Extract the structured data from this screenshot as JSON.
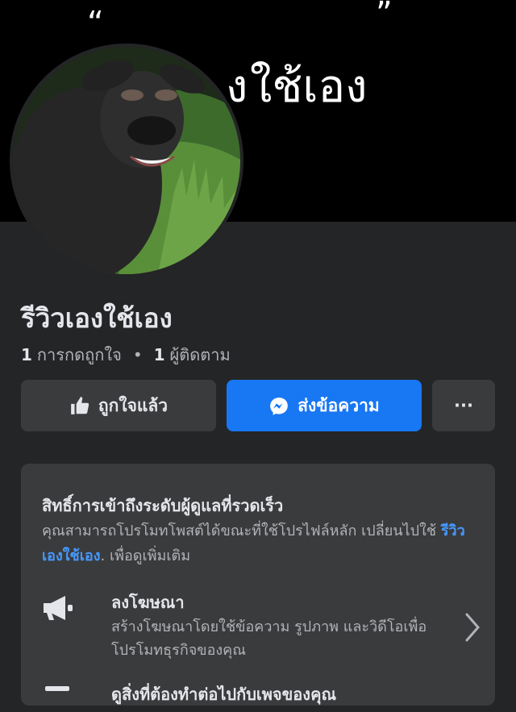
{
  "cover": {
    "text": "“ ..เองใช้เอง ”"
  },
  "page": {
    "name": "รีวิวเองใช้เอง",
    "likes_count": "1",
    "likes_label": "การกดถูกใจ",
    "followers_count": "1",
    "followers_label": "ผู้ติดตาม"
  },
  "actions": {
    "liked_label": "ถูกใจแล้ว",
    "message_label": "ส่งข้อความ",
    "more_label": "···"
  },
  "admin_card": {
    "title": "สิทธิ์การเข้าถึงระดับผู้ดูแลที่รวดเร็ว",
    "desc_before": "คุณสามารถโปรโมทโพสต์ได้ขณะที่ใช้โปรไฟล์หลัก เปลี่ยนไปใช้ ",
    "desc_link": "รีวิวเองใช้เอง",
    "desc_after": ". เพื่อดูเพิ่มเติม",
    "ad_title": "ลงโฆษณา",
    "ad_desc": "สร้างโฆษณาโดยใช้ข้อความ รูปภาพ และวิดีโอเพื่อโปรโมทธุรกิจของคุณ",
    "next_title": "ดูสิ่งที่ต้องทำต่อไปกับเพจของคุณ"
  },
  "colors": {
    "background": "#242526",
    "button_primary": "#1877f2",
    "button_secondary": "#3a3b3c",
    "link": "#4599ff"
  }
}
